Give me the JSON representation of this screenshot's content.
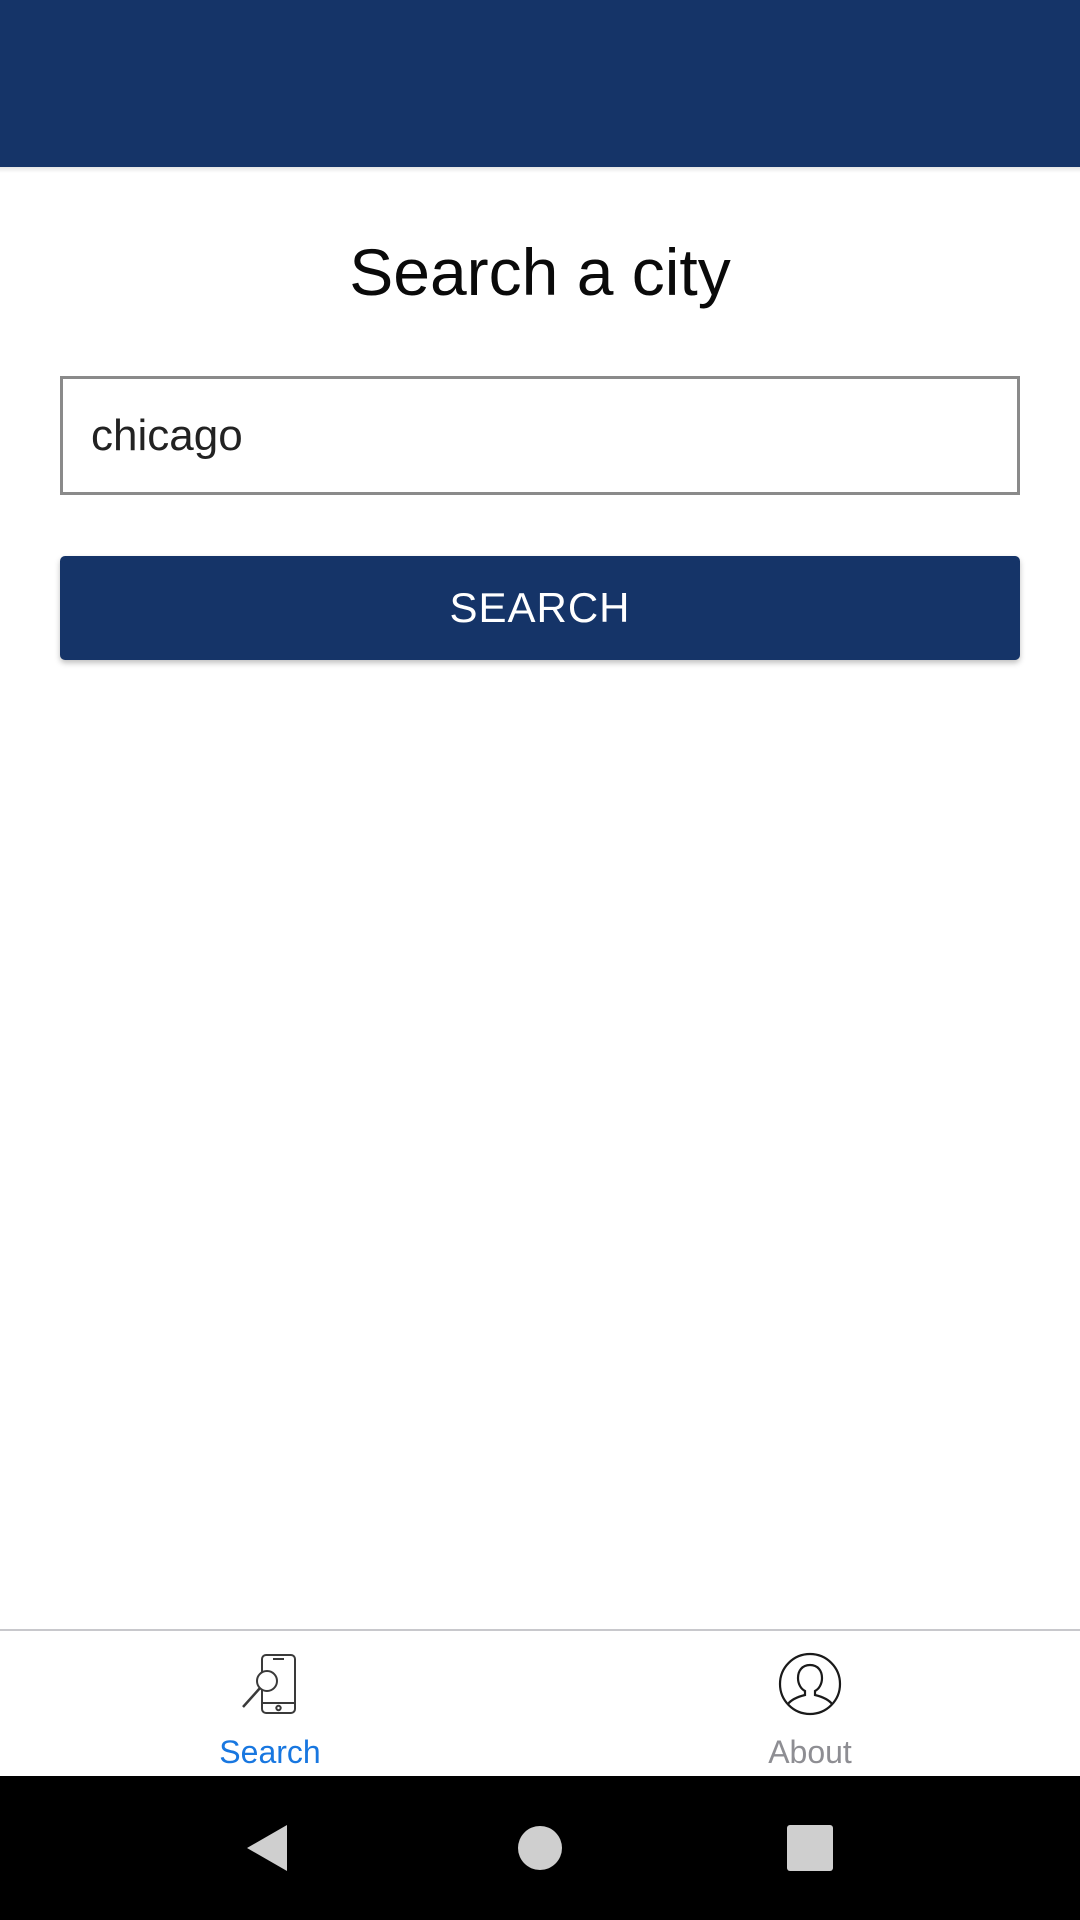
{
  "app": {
    "header_color": "#153468"
  },
  "main": {
    "title": "Search a city",
    "search_value": "chicago",
    "search_button_label": "SEARCH"
  },
  "tabs": [
    {
      "label": "Search",
      "icon": "phone-search-icon",
      "active": true
    },
    {
      "label": "About",
      "icon": "user-circle-icon",
      "active": false
    }
  ],
  "colors": {
    "primary": "#153468",
    "tab_active": "#1877e0",
    "tab_inactive": "#8e8e93"
  },
  "system_nav": {
    "icons": [
      "back-icon",
      "home-icon",
      "recents-icon"
    ]
  }
}
